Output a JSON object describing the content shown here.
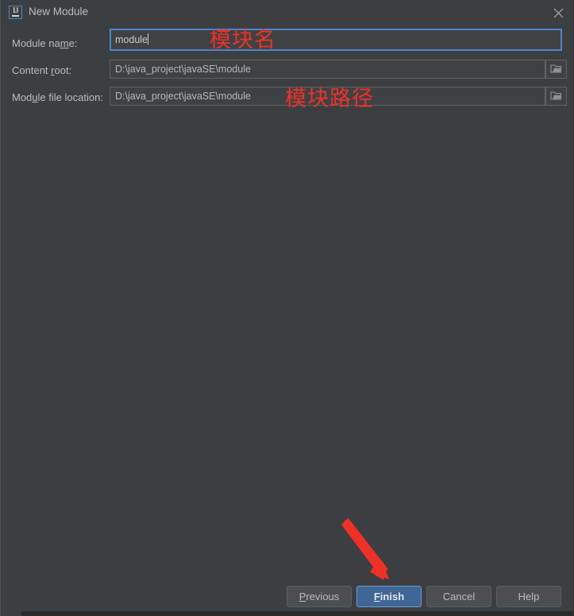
{
  "window": {
    "title": "New Module",
    "app_icon": "intellij-idea-icon",
    "close_icon": "close-icon",
    "background_color": "#3c3f41"
  },
  "form": {
    "fields": [
      {
        "label_before": "Module na",
        "label_mnemonic": "m",
        "label_after": "e:",
        "value": "module",
        "focused": true,
        "has_browse": false
      },
      {
        "label_before": "Content ",
        "label_mnemonic": "r",
        "label_after": "oot:",
        "value": "D:\\java_project\\javaSE\\module",
        "focused": false,
        "has_browse": true,
        "browse_icon": "folder-icon"
      },
      {
        "label_before": "Mod",
        "label_mnemonic": "u",
        "label_after": "le file location:",
        "value": "D:\\java_project\\javaSE\\module",
        "focused": false,
        "has_browse": true,
        "browse_icon": "folder-icon"
      }
    ]
  },
  "annotations": {
    "color": "#f03026",
    "module_name_text": "模块名",
    "module_path_text": "模块路径",
    "arrow": "red-arrow-pointing-to-finish"
  },
  "footer": {
    "buttons": [
      {
        "before": "",
        "mnemonic": "P",
        "after": "revious",
        "default": false
      },
      {
        "before": "",
        "mnemonic": "F",
        "after": "inish",
        "default": true
      },
      {
        "before": "",
        "mnemonic": "",
        "after": "Cancel",
        "default": false
      },
      {
        "before": "",
        "mnemonic": "",
        "after": "Help",
        "default": false
      }
    ],
    "default_button_color": "#3f6694"
  }
}
